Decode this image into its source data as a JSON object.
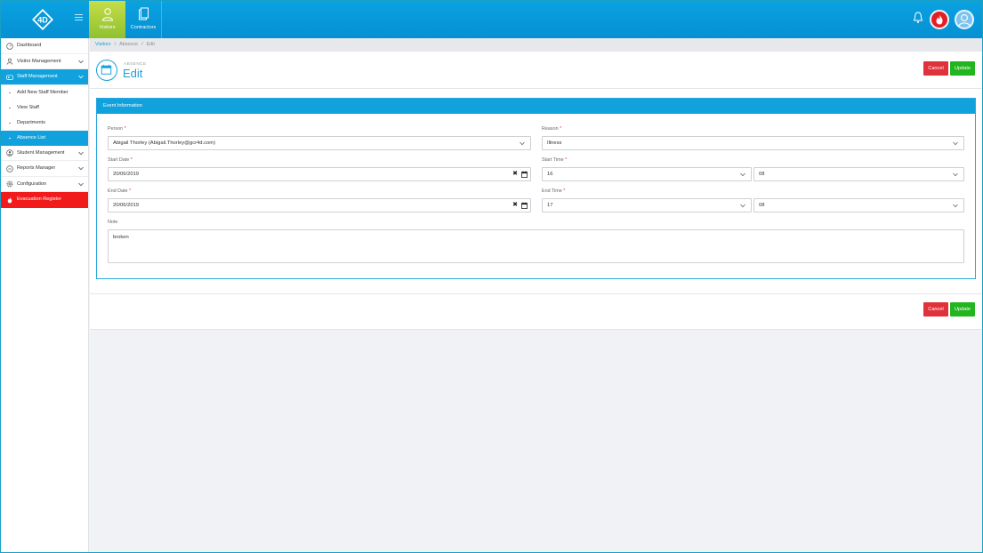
{
  "brand": {
    "logo_text": "4D",
    "accent": "#11a1dc",
    "visitors_green": "#8fc12f",
    "danger": "#e0323b",
    "success": "#22b51f"
  },
  "topbar": {
    "tabs": [
      {
        "label": "Visitors",
        "icon": "person-icon"
      },
      {
        "label": "Contractors",
        "icon": "clipboard-icon"
      }
    ],
    "actions": [
      "bell-icon",
      "fire-icon",
      "user-icon"
    ]
  },
  "sidebar": {
    "items": [
      {
        "label": "Dashboard",
        "icon": "gauge-icon"
      },
      {
        "label": "Visitor Management",
        "icon": "person-icon"
      },
      {
        "label": "Staff Management",
        "icon": "id-card-icon"
      },
      {
        "label": "Student Management",
        "icon": "student-icon"
      },
      {
        "label": "Reports Manager",
        "icon": "reports-icon"
      },
      {
        "label": "Configuration",
        "icon": "gear-icon"
      },
      {
        "label": "Evacuation Register",
        "icon": "fire-icon"
      }
    ],
    "staff_sub": [
      "Add New Staff Member",
      "View Staff",
      "Departments",
      "Absence List"
    ]
  },
  "breadcrumb": {
    "items": [
      "Visitors",
      "Absence",
      "Edit"
    ]
  },
  "page": {
    "kicker": "ABSENCE",
    "title": "Edit"
  },
  "buttons": {
    "cancel": "Cancel",
    "update": "Update"
  },
  "form": {
    "section_title": "Event Information",
    "person_label": "Person",
    "person_value": "Abigail Thorley (Abigail.Thorley@gcr4d.com)",
    "reason_label": "Reason",
    "reason_value": "Illness",
    "start_date_label": "Start Date",
    "start_date_value": "20/06/2019",
    "start_time_label": "Start Time",
    "start_hour": "16",
    "start_minute": "08",
    "end_date_label": "End Date",
    "end_date_value": "20/06/2019",
    "end_time_label": "End Time",
    "end_hour": "17",
    "end_minute": "08",
    "note_label": "Note",
    "note_value": "broken",
    "required_mark": "*",
    "clear_glyph": "✖"
  }
}
